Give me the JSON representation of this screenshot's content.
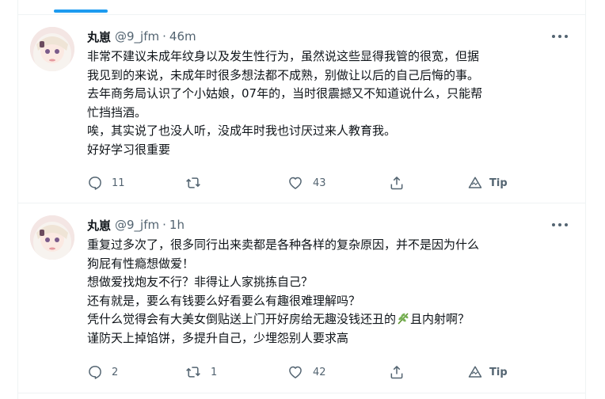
{
  "tweets": [
    {
      "name": "丸崽",
      "handle": "@9_jfm",
      "separator": "·",
      "time": "46m",
      "lines": [
        "非常不建议未成年纹身以及发生性行为，虽然说这些显得我管的很宽，但据",
        "我见到的来说，未成年时很多想法都不成熟，别做让以后的自己后悔的事。",
        "去年商务局认识了个小姑娘，07年的，当时很震撼又不知道说什么，只能帮",
        "忙挡挡酒。",
        "唉，其实说了也没人听，没成年时我也讨厌过来人教育我。",
        "好好学习很重要"
      ],
      "reply_count": "11",
      "retweet_count": "",
      "like_count": "43",
      "tip_label": "Tip"
    },
    {
      "name": "丸崽",
      "handle": "@9_jfm",
      "separator": "·",
      "time": "1h",
      "lines": [
        "重复过多次了，很多同行出来卖都是各种各样的复杂原因，并不是因为什么",
        "狗屁有性瘾想做爱！",
        "想做爱找炮友不行？非得让人家挑拣自己？",
        "还有就是，要么有钱要么好看要么有趣很难理解吗？",
        "凭什么觉得会有大美女倒贴送上门开好房给无趣没钱还丑的",
        "谨防天上掉馅饼，多提升自己，少埋怨别人要求高"
      ],
      "line5_after_emoji": "且内射啊？",
      "emoji_icon": "herb-emoji",
      "reply_count": "2",
      "retweet_count": "1",
      "like_count": "42",
      "tip_label": "Tip"
    }
  ],
  "colors": {
    "accent": "#1d9bf0",
    "text": "#0f1419",
    "secondary": "#536471",
    "divider": "#eff3f4"
  },
  "icons": [
    "more-icon",
    "reply-icon",
    "retweet-icon",
    "like-icon",
    "share-icon",
    "tip-icon",
    "herb-emoji"
  ]
}
